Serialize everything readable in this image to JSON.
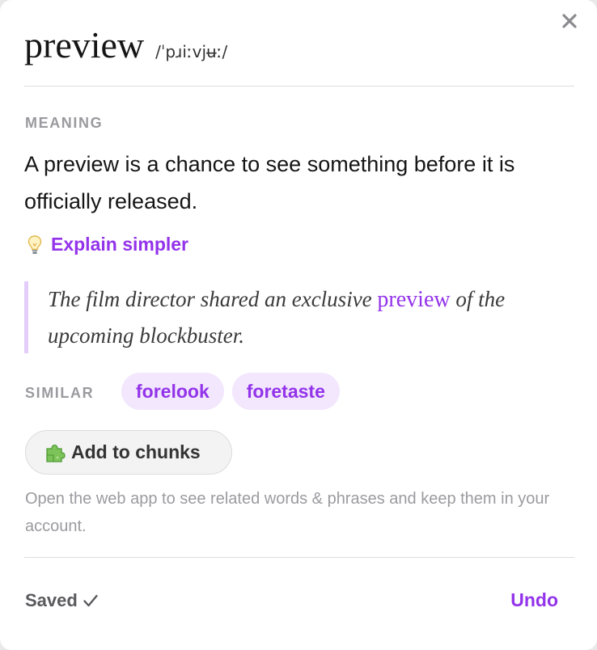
{
  "popup": {
    "word": "preview",
    "phonetic": "/ˈpɹiːvjʉː/",
    "meaning_label": "MEANING",
    "meaning": "A preview is a chance to see something before it is officially released.",
    "explain_label": "Explain simpler",
    "example": {
      "before": "The film director shared an exclusive ",
      "highlight": "preview",
      "after": " of the upcoming blockbuster."
    },
    "similar_label": "SIMILAR",
    "similar": [
      "forelook",
      "foretaste"
    ],
    "add_button_label": "Add to chunks",
    "note": "Open the web app to see related words & phrases and keep them in your account.",
    "status": "Saved",
    "undo_label": "Undo"
  },
  "icons": {
    "close": "close-icon",
    "explain": "lightbulb-icon",
    "add": "puzzle-icon",
    "saved": "checkmark-icon"
  },
  "colors": {
    "accent": "#9333ea",
    "chip_bg": "#f2e7fd",
    "quote_border": "#e3cdfa",
    "muted": "#9a9a9f"
  }
}
